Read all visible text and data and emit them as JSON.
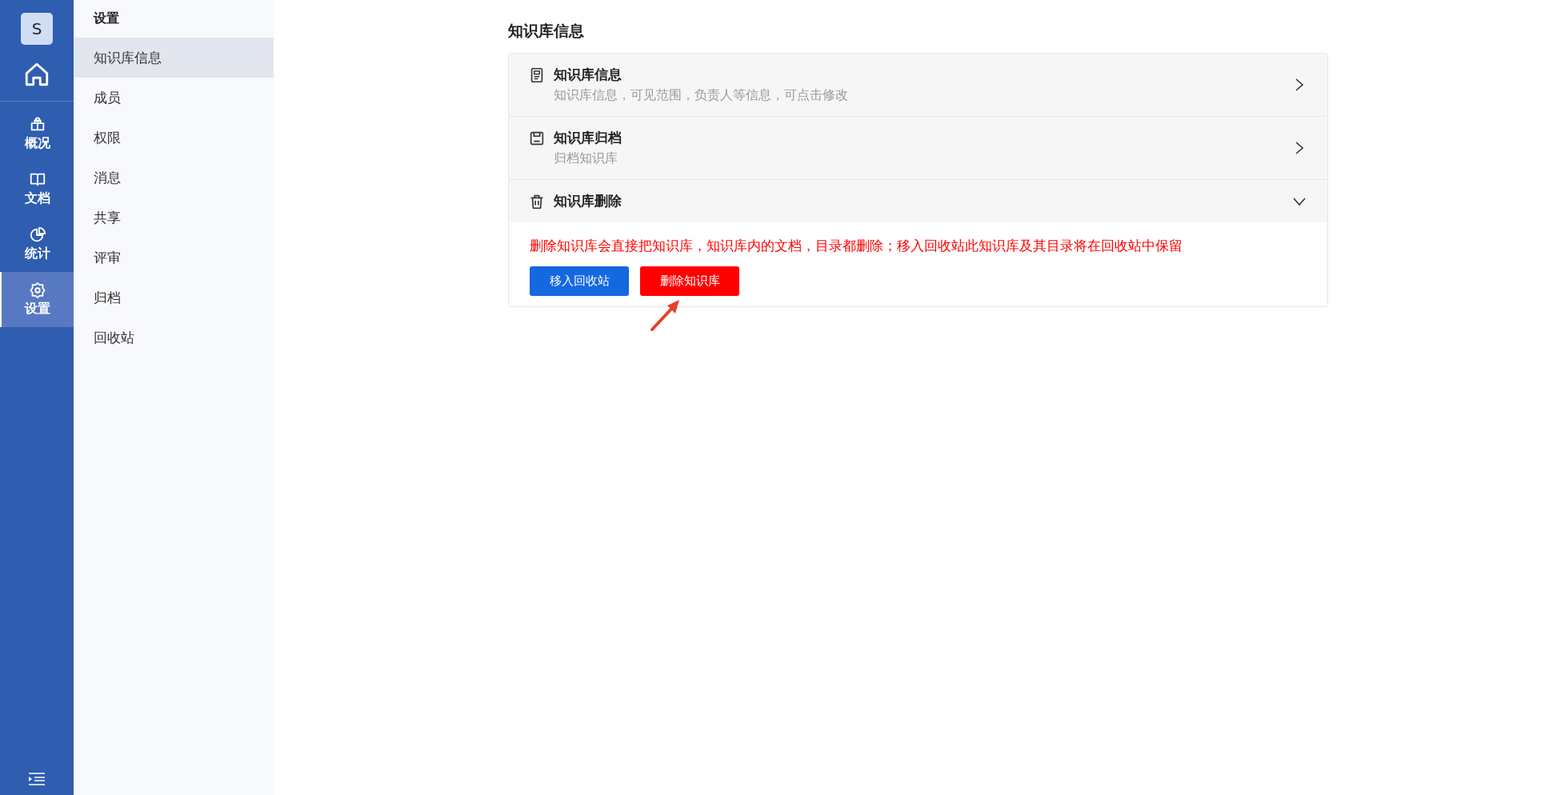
{
  "rail": {
    "avatar": "S",
    "items": [
      {
        "label": "概况",
        "selected": false
      },
      {
        "label": "文档",
        "selected": false
      },
      {
        "label": "统计",
        "selected": false
      },
      {
        "label": "设置",
        "selected": true
      }
    ]
  },
  "sidebar": {
    "title": "设置",
    "items": [
      {
        "label": "知识库信息",
        "selected": true
      },
      {
        "label": "成员",
        "selected": false
      },
      {
        "label": "权限",
        "selected": false
      },
      {
        "label": "消息",
        "selected": false
      },
      {
        "label": "共享",
        "selected": false
      },
      {
        "label": "评审",
        "selected": false
      },
      {
        "label": "归档",
        "selected": false
      },
      {
        "label": "回收站",
        "selected": false
      }
    ]
  },
  "page_title": "知识库信息",
  "sections": [
    {
      "title": "知识库信息",
      "subtitle": "知识库信息，可见范围，负责人等信息，可点击修改",
      "expanded": false
    },
    {
      "title": "知识库归档",
      "subtitle": "归档知识库",
      "expanded": false
    },
    {
      "title": "知识库删除",
      "expanded": true,
      "warning": "删除知识库会直接把知识库，知识库内的文档，目录都删除；移入回收站此知识库及其目录将在回收站中保留",
      "buttons": [
        {
          "label": "移入回收站",
          "kind": "primary"
        },
        {
          "label": "删除知识库",
          "kind": "danger"
        }
      ]
    }
  ]
}
